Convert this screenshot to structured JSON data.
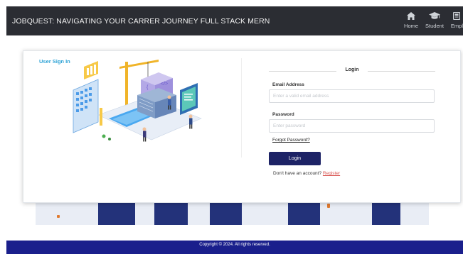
{
  "navbar": {
    "brand": "JOBQUEST: NAVIGATING YOUR CARRER JOURNEY FULL STACK MERN",
    "items": [
      {
        "label": "Home",
        "icon": "home-icon"
      },
      {
        "label": "Student",
        "icon": "graduation-cap-icon"
      },
      {
        "label": "Empl",
        "icon": "employer-icon"
      }
    ]
  },
  "card": {
    "title": "User Sign In",
    "illustration": "isometric-construction-illustration"
  },
  "login": {
    "heading": "Login",
    "email_label": "Email Address",
    "email_placeholder": "Enter a valid email address",
    "email_value": "",
    "password_label": "Password",
    "password_placeholder": "Enter password",
    "password_value": "",
    "forgot_link": "Forgot Password?",
    "button_label": "Login",
    "no_account_text": "Don't have an account?",
    "register_link": "Register"
  },
  "footer": {
    "copyright": "Copyright © 2024. All rights reserved."
  },
  "colors": {
    "navbar_bg": "#2b2d33",
    "accent_title": "#2ea3d6",
    "login_button": "#1d2366",
    "footer_bg": "#1a1f8c",
    "register_link": "#d9534f"
  }
}
